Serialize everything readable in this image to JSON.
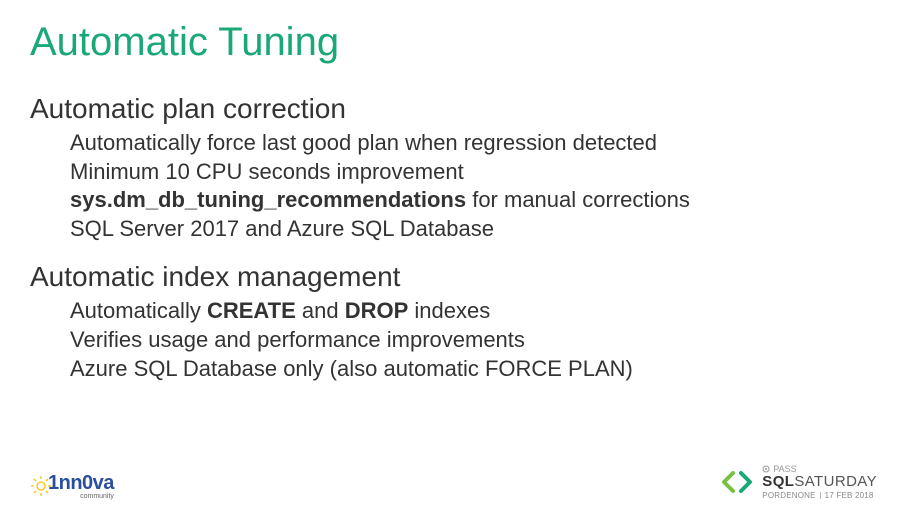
{
  "title": "Automatic Tuning",
  "sections": [
    {
      "heading": "Automatic plan correction",
      "items": [
        {
          "html": "Automatically force last good plan when regression detected"
        },
        {
          "html": "Minimum 10 CPU seconds improvement"
        },
        {
          "html": "<b>sys.dm_db_tuning_recommendations</b> for manual corrections"
        },
        {
          "html": "SQL Server 2017 and Azure SQL Database"
        }
      ]
    },
    {
      "heading": "Automatic index management",
      "items": [
        {
          "html": "Automatically <b>CREATE</b> and <b>DROP</b> indexes"
        },
        {
          "html": "Verifies usage and performance improvements"
        },
        {
          "html": "Azure SQL Database only (also automatic FORCE PLAN)"
        }
      ]
    }
  ],
  "footer": {
    "left": {
      "brand": "1nn0va",
      "sub": "community"
    },
    "right": {
      "pass": "PASS",
      "title_a": "SQL",
      "title_b": "SATURDAY",
      "city": "PORDENONE",
      "date": "17 FEB 2018"
    }
  },
  "colors": {
    "accent": "#1aa876",
    "brand_blue": "#2a4fa0",
    "sun": "#f4c20d"
  }
}
